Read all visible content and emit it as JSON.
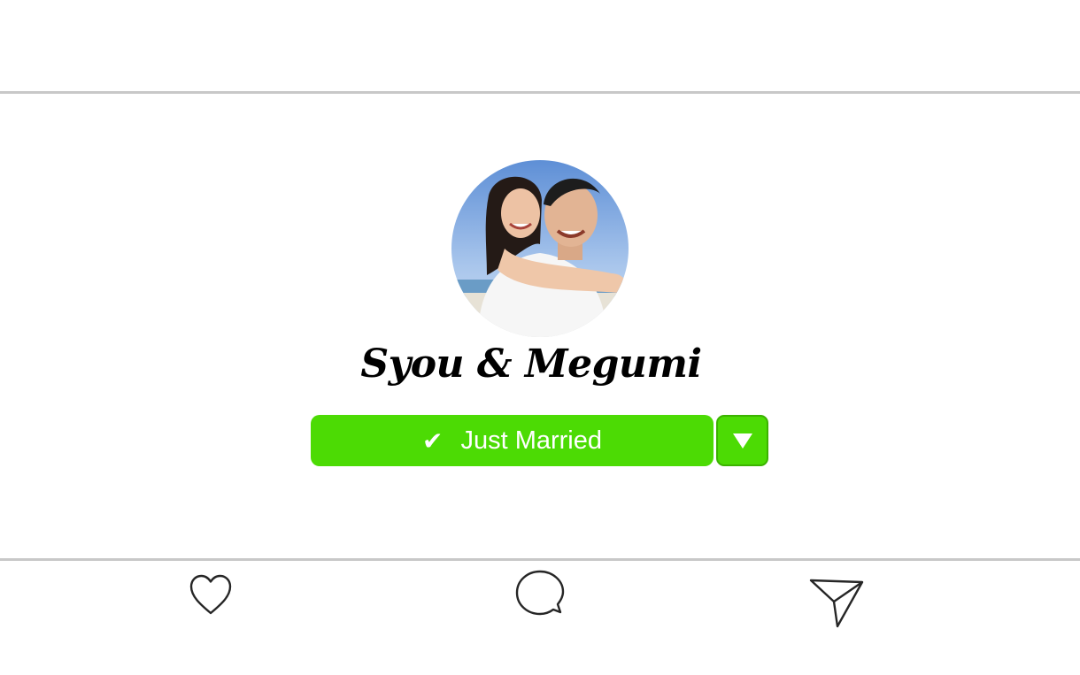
{
  "profile": {
    "name": "Syou & Megumi",
    "avatar_icon": "couple-photo"
  },
  "status": {
    "check_icon": "✔",
    "label": "Just Married",
    "dropdown_icon": "chevron-down-icon"
  },
  "actions": {
    "like_icon": "heart-icon",
    "comment_icon": "comment-bubble-icon",
    "share_icon": "paper-plane-icon"
  },
  "colors": {
    "accent": "#4cdb04",
    "accent_border": "#3bb300",
    "divider": "#c8c8c8"
  }
}
